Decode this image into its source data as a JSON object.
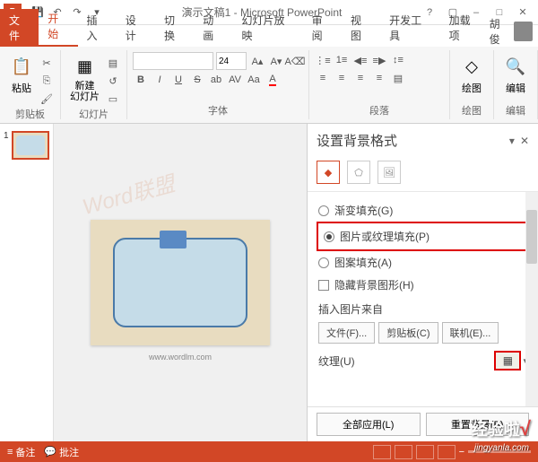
{
  "titlebar": {
    "app_icon": "P",
    "title": "演示文稿1 - Microsoft PowerPoint"
  },
  "tabs": {
    "file": "文件",
    "home": "开始",
    "insert": "插入",
    "design": "设计",
    "transition": "切换",
    "animation": "动画",
    "slideshow": "幻灯片放映",
    "review": "审阅",
    "view": "视图",
    "dev": "开发工具",
    "addin": "加载项"
  },
  "user": {
    "name": "胡俊"
  },
  "ribbon": {
    "clipboard": {
      "paste": "粘贴",
      "label": "剪贴板"
    },
    "slides": {
      "new": "新建\n幻灯片",
      "label": "幻灯片"
    },
    "font": {
      "size": "24",
      "label": "字体"
    },
    "paragraph": {
      "label": "段落"
    },
    "drawing": {
      "btn": "绘图",
      "label": "绘图"
    },
    "editing": {
      "btn": "编辑",
      "label": "编辑"
    }
  },
  "thumb": {
    "num": "1"
  },
  "slide": {
    "url": "www.wordlm.com"
  },
  "pane": {
    "title": "设置背景格式",
    "opt_gradient": "渐变填充(G)",
    "opt_picture": "图片或纹理填充(P)",
    "opt_pattern": "图案填充(A)",
    "opt_hide": "隐藏背景图形(H)",
    "insert_label": "插入图片来自",
    "btn_file": "文件(F)...",
    "btn_clipboard": "剪贴板(C)",
    "btn_online": "联机(E)...",
    "texture_label": "纹理(U)",
    "btn_apply_all": "全部应用(L)",
    "btn_reset": "重置背景(B)"
  },
  "status": {
    "notes": "备注",
    "comments": "批注"
  },
  "overlay": {
    "brand": "经验啦",
    "url": "jingyanla.com"
  }
}
